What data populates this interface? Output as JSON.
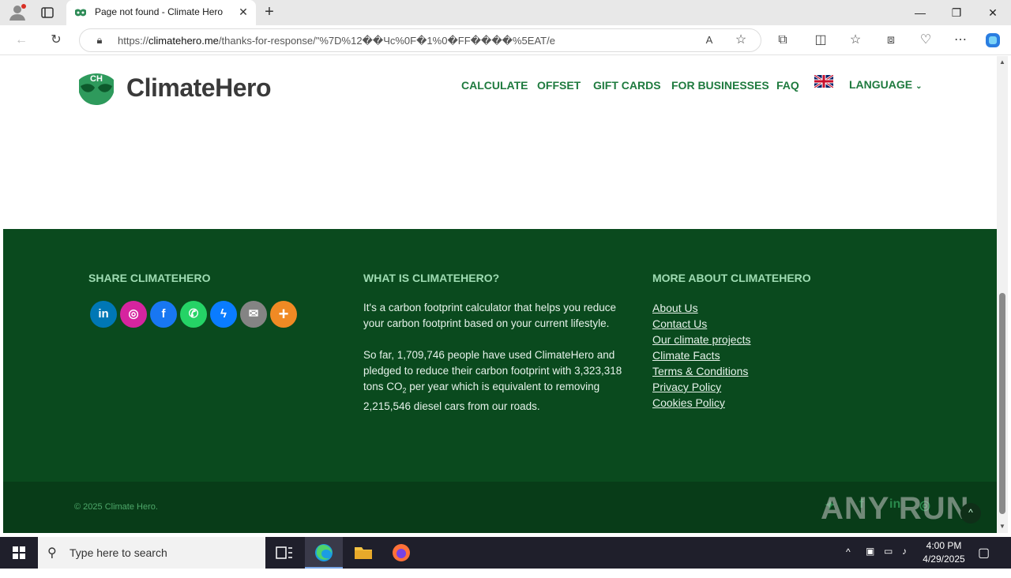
{
  "browser": {
    "tab_title": "Page not found - Climate Hero",
    "url_prefix": "https://",
    "url_host": "climatehero.me",
    "url_path": "/thanks-for-response/\"%7D%12��Чс%0F�1%0�FF����%5EAT/e"
  },
  "site": {
    "logo_text": "ClimateHero",
    "logo_badge": "CH",
    "nav": [
      "CALCULATE",
      "OFFSET",
      "GIFT CARDS",
      "FOR BUSINESSES",
      "FAQ"
    ],
    "language_label": "LANGUAGE"
  },
  "footer": {
    "share_title": "SHARE CLIMATEHERO",
    "share_icons": [
      {
        "name": "linkedin-icon",
        "glyph": "in",
        "color": "#0077b5"
      },
      {
        "name": "instagram-icon",
        "glyph": "◎",
        "color": "#d6249f"
      },
      {
        "name": "facebook-icon",
        "glyph": "f",
        "color": "#1877f2"
      },
      {
        "name": "whatsapp-icon",
        "glyph": "✆",
        "color": "#25d366"
      },
      {
        "name": "messenger-icon",
        "glyph": "ϟ",
        "color": "#0a7cff"
      },
      {
        "name": "email-icon",
        "glyph": "✉",
        "color": "#848484"
      },
      {
        "name": "more-icon",
        "glyph": "+",
        "color": "#f08a24"
      }
    ],
    "what_title": "WHAT IS CLIMATEHERO?",
    "what_p1": "It's a carbon footprint calculator that helps you reduce your carbon footprint based on your current lifestyle.",
    "what_p2_a": "So far, 1,709,746 people have used ClimateHero and pledged to reduce their carbon footprint with 3,323,318 tons CO",
    "what_p2_sub": "2",
    "what_p2_b": " per year which is equivalent to removing 2,215,546 diesel cars from our roads.",
    "more_title": "MORE ABOUT CLIMATEHERO",
    "more_links": [
      "About Us",
      "Contact Us",
      "Our climate projects",
      "Climate Facts",
      "Terms & Conditions",
      "Privacy Policy",
      "Cookies Policy"
    ],
    "copyright": "© 2025 Climate Hero.",
    "watermark": "ANY RUN"
  },
  "taskbar": {
    "search_placeholder": "Type here to search",
    "time": "4:00 PM",
    "date": "4/29/2025"
  },
  "colors": {
    "brand_green": "#1e7a3e",
    "footer_bg": "#0a4a1e",
    "footer_bottom_bg": "#083c18"
  }
}
